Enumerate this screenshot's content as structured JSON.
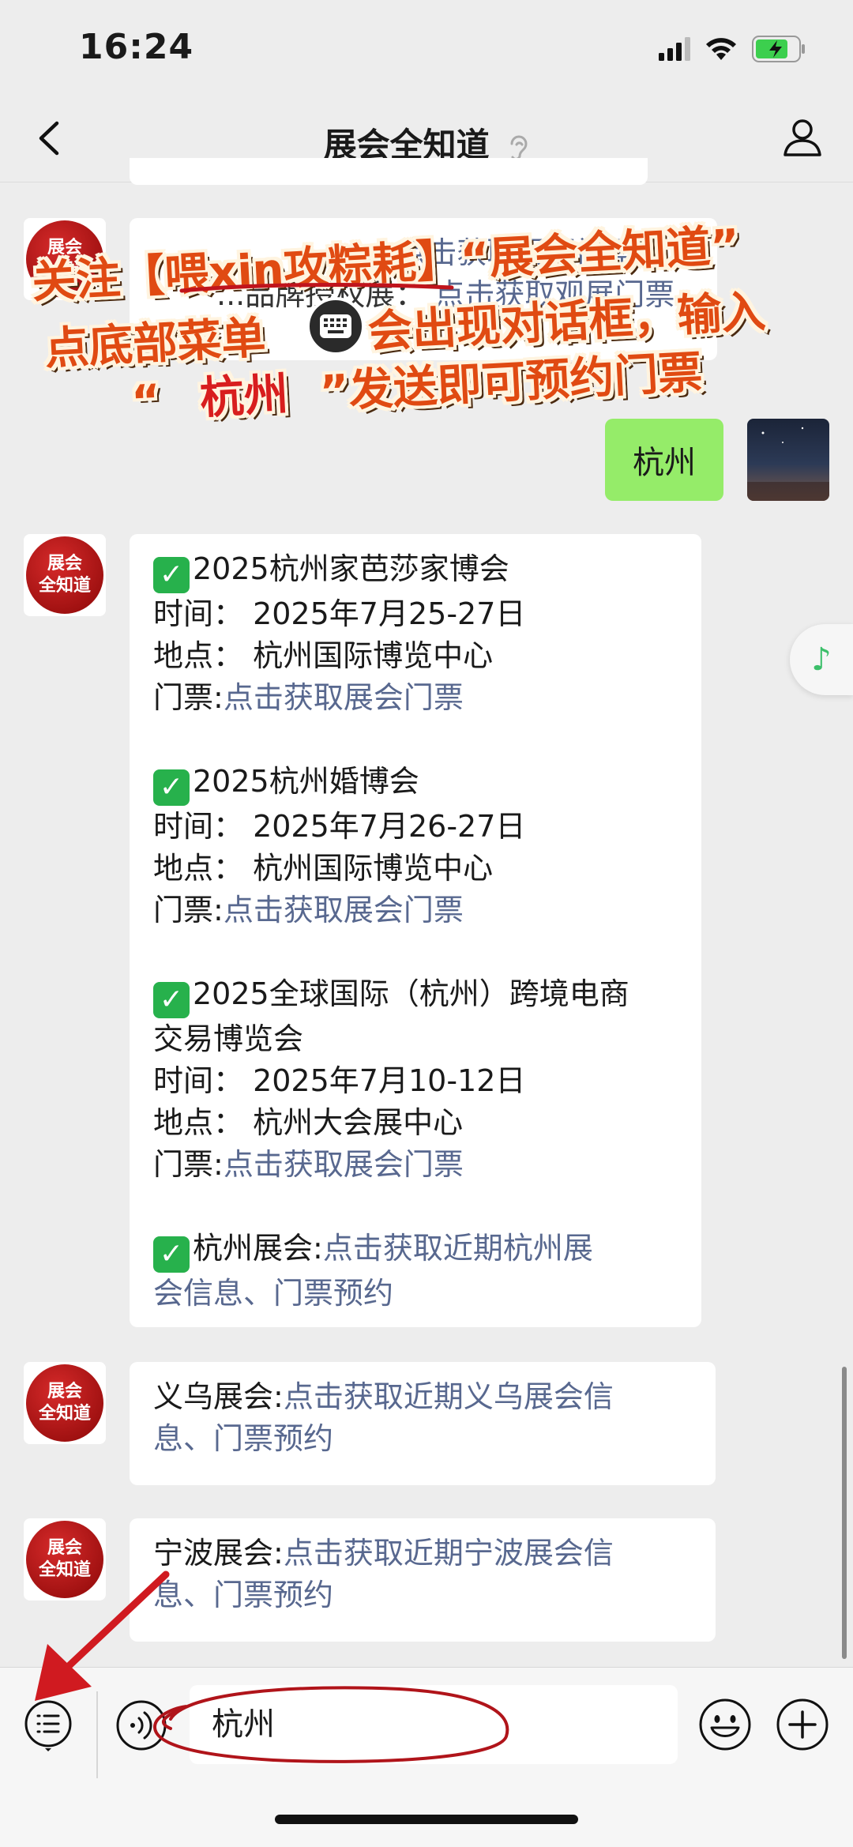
{
  "status_bar": {
    "time": "16:24"
  },
  "nav": {
    "title": "展会全知道"
  },
  "avatar_label": {
    "line1": "展会",
    "line2": "全知道"
  },
  "partial_top": {
    "text1": "...",
    "link1": "点击获取观展门票",
    "text2": "...品牌授权展：",
    "link2": "点击获取观展门票"
  },
  "user_message": {
    "text": "杭州"
  },
  "reply1": {
    "items": [
      {
        "title": "2025杭州家芭莎家博会",
        "time": "时间： 2025年7月25-27日",
        "place": "地点： 杭州国际博览中心",
        "ticket_label": "门票:",
        "ticket_link": "点击获取展会门票"
      },
      {
        "title": "2025杭州婚博会",
        "time": "时间： 2025年7月26-27日",
        "place": "地点： 杭州国际博览中心",
        "ticket_label": "门票:",
        "ticket_link": "点击获取展会门票"
      },
      {
        "title_l1": "2025全球国际（杭州）跨境电商",
        "title_l2": "交易博览会",
        "time": "时间： 2025年7月10-12日",
        "place": "地点： 杭州大会展中心",
        "ticket_label": "门票:",
        "ticket_link": "点击获取展会门票"
      }
    ],
    "final_label": "杭州展会:",
    "final_link_l1": "点击获取近期杭州展",
    "final_link_l2": "会信息、门票预约"
  },
  "reply2": {
    "label": "义乌展会:",
    "link_l1": "点击获取近期义乌展会信",
    "link_l2": "息、门票预约"
  },
  "reply3": {
    "label": "宁波展会:",
    "link_l1": "点击获取近期宁波展会信",
    "link_l2": "息、门票预约"
  },
  "overlay": {
    "line1a": "关注",
    "line1b": "【喂xin攻粽耗】",
    "line1c": "“展会全知道”",
    "line2a": "点底部菜单",
    "line2b": "会出现对话框，输入",
    "line3a": "“",
    "line3b": "杭州",
    "line3c": "”发送即可预约门票"
  },
  "input": {
    "value": "杭州"
  },
  "icons": {
    "back": "chevron-left-icon",
    "profile": "person-icon",
    "ear": "ear-icon",
    "menu": "list-menu-icon",
    "voice": "voice-icon",
    "emoji": "emoji-icon",
    "plus": "plus-icon",
    "music": "music-note-icon",
    "keyboard": "keyboard-icon"
  },
  "colors": {
    "link": "#58688f",
    "user_bubble": "#95ec69",
    "overlay_text": "#e04a12",
    "annotation": "#c0141c",
    "check": "#27b14c"
  }
}
